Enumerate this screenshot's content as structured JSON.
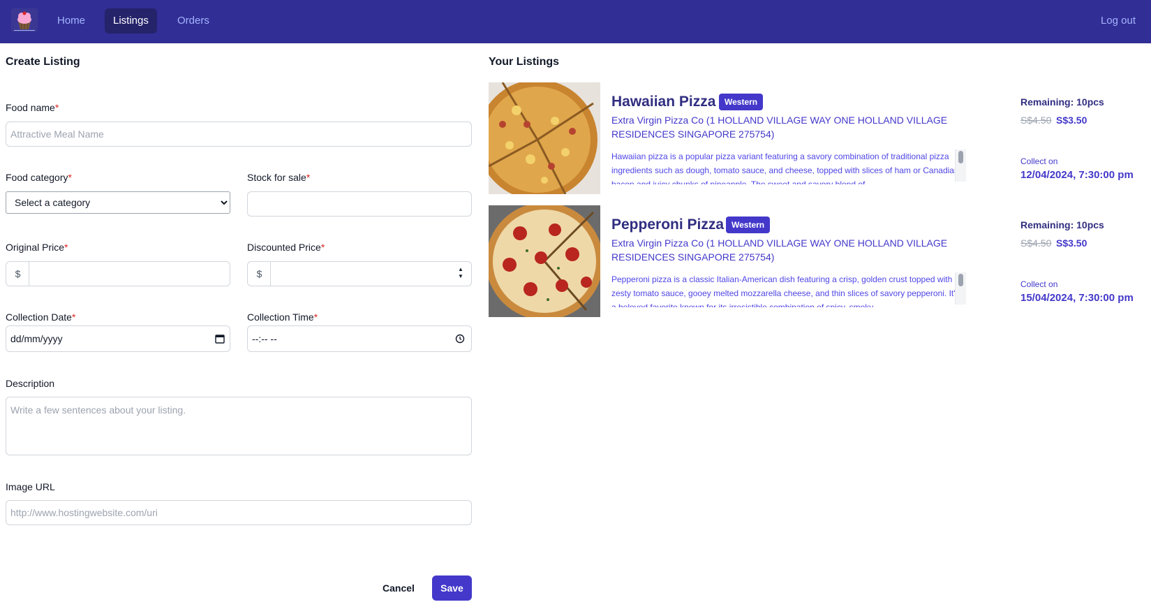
{
  "nav": {
    "items": [
      {
        "label": "Home"
      },
      {
        "label": "Listings"
      },
      {
        "label": "Orders"
      }
    ],
    "logout_label": "Log out"
  },
  "form": {
    "title": "Create Listing",
    "food_name": {
      "label": "Food name",
      "required_mark": "*",
      "placeholder": "Attractive Meal Name",
      "value": ""
    },
    "food_category": {
      "label": "Food category",
      "required_mark": "*",
      "selected": "Select a category"
    },
    "stock": {
      "label": "Stock for sale",
      "required_mark": "*",
      "value": ""
    },
    "original_price": {
      "label": "Original Price",
      "required_mark": "*",
      "prefix": "$",
      "value": ""
    },
    "discounted_price": {
      "label": "Discounted Price",
      "required_mark": "*",
      "prefix": "$",
      "value": ""
    },
    "collection_date": {
      "label": "Collection Date",
      "required_mark": "*",
      "value_display": "dd/mm/yyyy"
    },
    "collection_time": {
      "label": "Collection Time",
      "required_mark": "*",
      "value_display": "--:-- --"
    },
    "description": {
      "label": "Description",
      "placeholder": "Write a few sentences about your listing."
    },
    "image_url": {
      "label": "Image URL",
      "placeholder": "http://www.hostingwebsite.com/uri"
    },
    "cancel_label": "Cancel",
    "save_label": "Save"
  },
  "listings": {
    "title": "Your Listings",
    "items": [
      {
        "name": "Hawaiian Pizza",
        "category": "Western",
        "address": "Extra Virgin Pizza Co (1 HOLLAND VILLAGE WAY ONE HOLLAND VILLAGE RESIDENCES SINGAPORE 275754)",
        "description": "Hawaiian pizza is a popular pizza variant featuring a savory combination of traditional pizza ingredients such as dough, tomato sauce, and cheese, topped with slices of ham or Canadian bacon and juicy chunks of pineapple. The sweet and savory blend of",
        "remaining": "Remaining: 10pcs",
        "original_price": "S$4.50",
        "discounted_price": "S$3.50",
        "collect_label": "Collect on",
        "collect_date": "12/04/2024, 7:30:00 pm"
      },
      {
        "name": "Pepperoni Pizza",
        "category": "Western",
        "address": "Extra Virgin Pizza Co (1 HOLLAND VILLAGE WAY ONE HOLLAND VILLAGE RESIDENCES SINGAPORE 275754)",
        "description": "Pepperoni pizza is a classic Italian-American dish featuring a crisp, golden crust topped with zesty tomato sauce, gooey melted mozzarella cheese, and thin slices of savory pepperoni. It's a beloved favorite known for its irresistible combination of spicy, smoky",
        "remaining": "Remaining: 10pcs",
        "original_price": "S$4.50",
        "discounted_price": "S$3.50",
        "collect_label": "Collect on",
        "collect_date": "15/04/2024, 7:30:00 pm"
      }
    ]
  },
  "colors": {
    "nav_bg": "#312e96",
    "accent": "#4338ca",
    "required": "#dc2626"
  }
}
